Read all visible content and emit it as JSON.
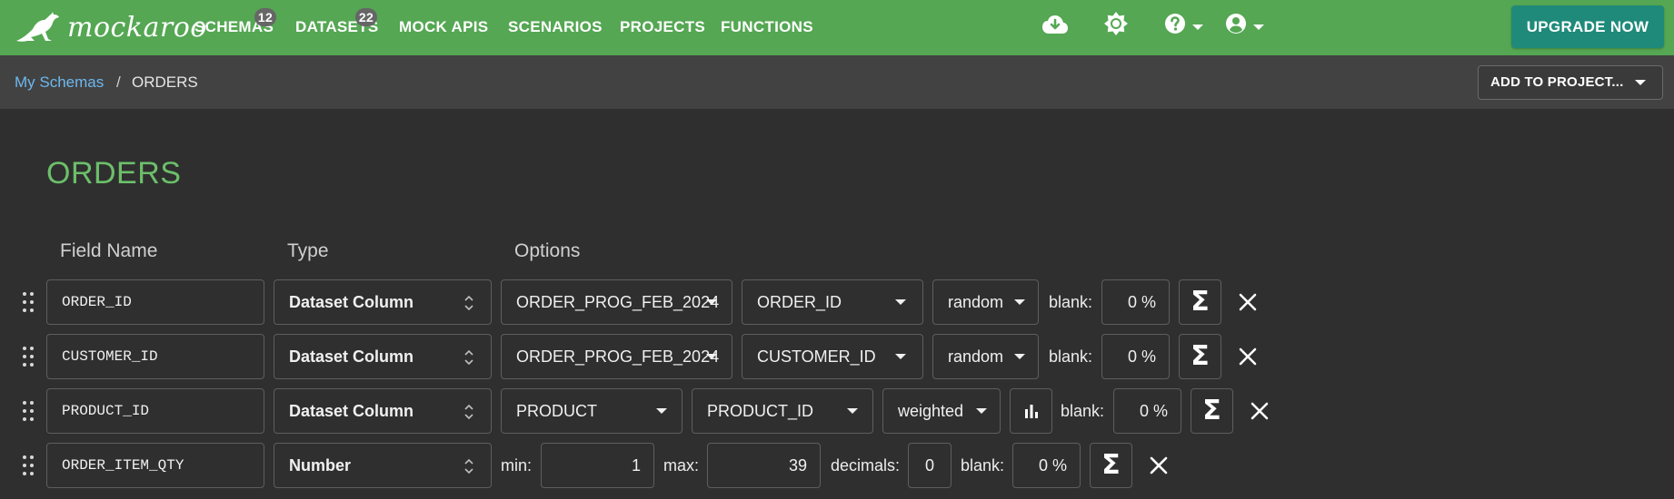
{
  "brand": {
    "name": "mockaroo"
  },
  "nav": {
    "items": [
      {
        "label": "SCHEMAS",
        "badge": "12"
      },
      {
        "label": "DATASETS",
        "badge": "22"
      },
      {
        "label": "MOCK APIS"
      },
      {
        "label": "SCENARIOS"
      },
      {
        "label": "PROJECTS"
      },
      {
        "label": "FUNCTIONS"
      }
    ],
    "icons": [
      "cloud-download-icon",
      "brightness-icon",
      "help-icon",
      "account-icon"
    ],
    "upgrade_label": "UPGRADE NOW"
  },
  "breadcrumb": {
    "link": "My Schemas",
    "separator": "/",
    "current": "ORDERS"
  },
  "add_to_project_label": "ADD TO PROJECT...",
  "schema": {
    "title": "ORDERS",
    "columns": {
      "field_name": "Field Name",
      "type": "Type",
      "options": "Options"
    },
    "fields": [
      {
        "name": "ORDER_ID",
        "type": "Dataset Column",
        "dataset": "ORDER_PROG_FEB_2024",
        "column": "ORDER_ID",
        "mode": "random",
        "blank_label": "blank:",
        "blank": "0 %"
      },
      {
        "name": "CUSTOMER_ID",
        "type": "Dataset Column",
        "dataset": "ORDER_PROG_FEB_2024",
        "column": "CUSTOMER_ID",
        "mode": "random",
        "blank_label": "blank:",
        "blank": "0 %"
      },
      {
        "name": "PRODUCT_ID",
        "type": "Dataset Column",
        "dataset": "PRODUCT",
        "column": "PRODUCT_ID",
        "mode": "weighted",
        "blank_label": "blank:",
        "blank": "0 %"
      },
      {
        "name": "ORDER_ITEM_QTY",
        "type": "Number",
        "min_label": "min:",
        "min": "1",
        "max_label": "max:",
        "max": "39",
        "decimals_label": "decimals:",
        "decimals": "0",
        "blank_label": "blank:",
        "blank": "0 %"
      }
    ]
  },
  "colors": {
    "nav_bg": "#55a753",
    "upgrade_bg": "#1f8a7a",
    "title": "#6cbf6a",
    "link": "#6db8ef",
    "page_bg": "#2f2f2f"
  }
}
